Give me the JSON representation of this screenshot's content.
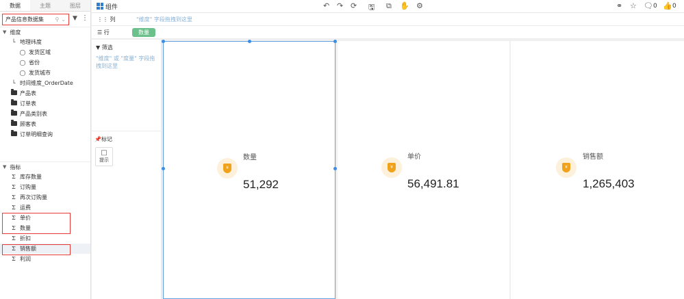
{
  "left_panel": {
    "tabs": [
      "数据",
      "主题",
      "图层"
    ],
    "dataset_name": "产品信息数据集",
    "dimensions_header": "维度",
    "dimensions": [
      {
        "label": "地理纬度",
        "level": 1,
        "icon": "hierarchy-icon"
      },
      {
        "label": "发货区域",
        "level": 2,
        "icon": "globe-icon"
      },
      {
        "label": "省份",
        "level": 2,
        "icon": "globe-icon"
      },
      {
        "label": "发货城市",
        "level": 2,
        "icon": "globe-icon"
      },
      {
        "label": "时间维度_OrderDate",
        "level": 1,
        "icon": "hierarchy-icon"
      },
      {
        "label": "产品表",
        "level": 1,
        "icon": "folder-icon"
      },
      {
        "label": "订单表",
        "level": 1,
        "icon": "folder-icon"
      },
      {
        "label": "产品类别表",
        "level": 1,
        "icon": "folder-icon"
      },
      {
        "label": "顾客表",
        "level": 1,
        "icon": "folder-icon"
      },
      {
        "label": "订单明细查询",
        "level": 1,
        "icon": "folder-icon"
      }
    ],
    "measures_header": "指标",
    "measures": [
      "库存数量",
      "订购量",
      "再次订购量",
      "运费",
      "单价",
      "数量",
      "折扣",
      "销售额",
      "利润"
    ]
  },
  "toolbar": {
    "title": "组件",
    "comment_count": "0",
    "like_count": "0"
  },
  "shelves": {
    "columns_label": "列",
    "columns_hint": "\"维度\" 字段拖拽到这里",
    "rows_label": "行",
    "rows_pill": "数量"
  },
  "filter_panel": {
    "title": "筛选",
    "hint": "\"维度\" 或 \"度量\" 字段拖拽到这里",
    "marks_title": "标记",
    "tip_label": "提示"
  },
  "kpi_cards": [
    {
      "label": "数量",
      "value": "51,292"
    },
    {
      "label": "单价",
      "value": "56,491.81"
    },
    {
      "label": "销售额",
      "value": "1,265,403"
    }
  ],
  "colors": {
    "accent": "#3a8ee6",
    "pill": "#6cc08b",
    "kpi_icon": "#f0a21b",
    "highlight": "#e53935"
  }
}
